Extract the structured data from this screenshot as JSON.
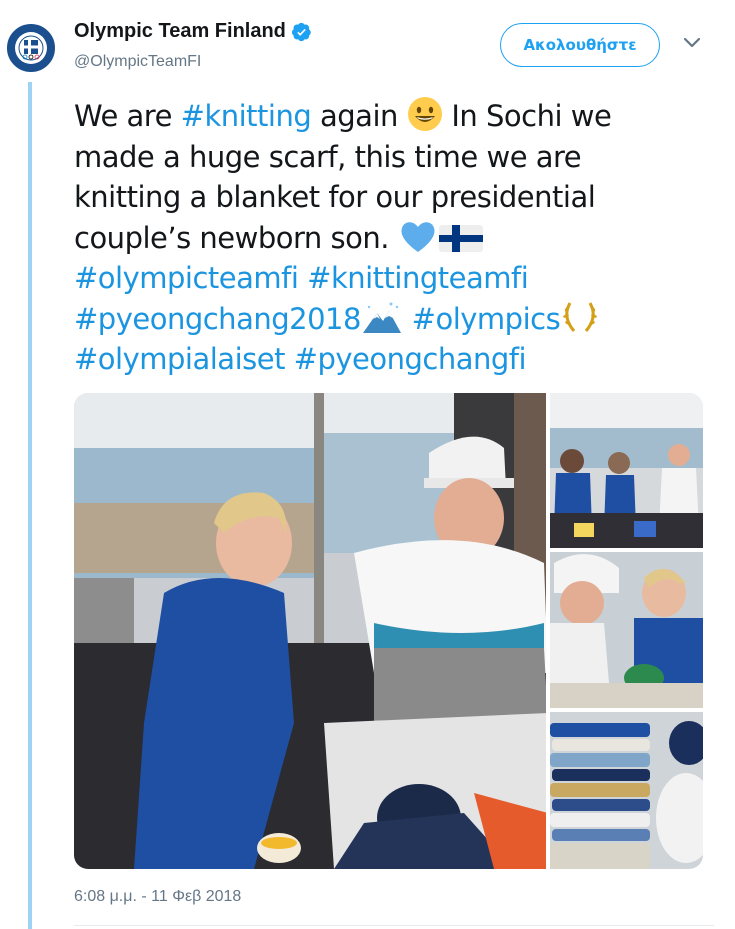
{
  "account": {
    "name": "Olympic Team Finland",
    "handle": "@OlympicTeamFI",
    "avatar_text": "OLYMPIC TEAM FINLAND"
  },
  "follow_label": "Ακολουθήστε",
  "tweet": {
    "line1_a": "We are ",
    "line1_tag": "#knitting",
    "line1_b": " again ",
    "line1_c": " In Sochi we",
    "line2": "made a huge scarf, this time we are",
    "line3": "knitting a blanket for our presidential",
    "line4": "couple’s newborn son. ",
    "line5_tag1": "#olympicteamfi",
    "line5_tag2": "#knittingteamfi",
    "line6_tag1": "#pyeongchang2018",
    "line6_tag2": "#olympics",
    "line7_tag1": "#olympialaiset",
    "line7_tag2": "#pyeongchangfi"
  },
  "timestamp": "6:08 μ.μ. - 11 Φεβ 2018",
  "colors": {
    "link": "#1b95e0",
    "follow": "#1da1f2",
    "thread": "#9fd3f3",
    "muted": "#657786"
  },
  "icons": [
    "verified-badge-icon",
    "chevron-down-icon",
    "grinning-face-emoji",
    "blue-heart-emoji",
    "finland-flag-emoji",
    "snow-mountain-emoji",
    "laurel-wreath-emoji"
  ]
}
